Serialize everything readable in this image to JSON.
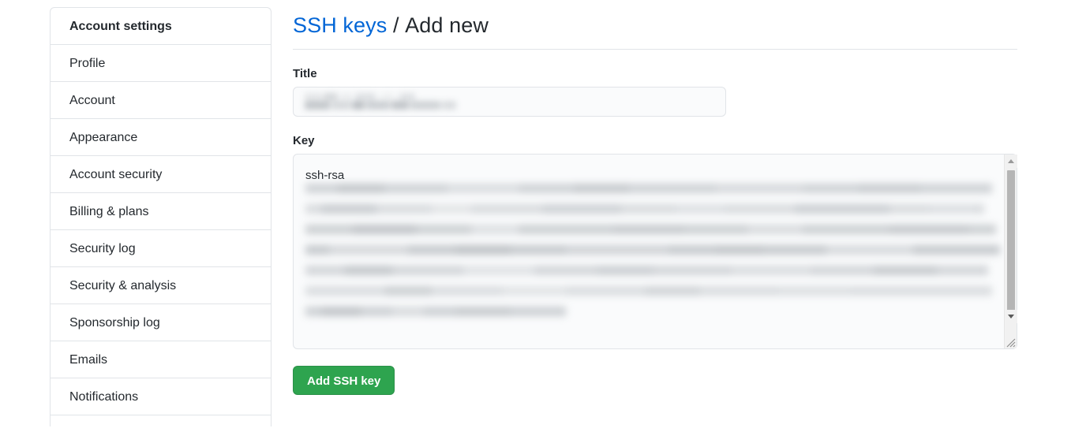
{
  "sidebar": {
    "header": "Account settings",
    "items": [
      {
        "label": "Profile"
      },
      {
        "label": "Account"
      },
      {
        "label": "Appearance"
      },
      {
        "label": "Account security"
      },
      {
        "label": "Billing & plans"
      },
      {
        "label": "Security log"
      },
      {
        "label": "Security & analysis"
      },
      {
        "label": "Sponsorship log"
      },
      {
        "label": "Emails"
      },
      {
        "label": "Notifications"
      }
    ],
    "clipped_item": ""
  },
  "header": {
    "breadcrumb_link": "SSH keys",
    "breadcrumb_separator": "/",
    "breadcrumb_current": "Add new"
  },
  "form": {
    "title_label": "Title",
    "title_value": "",
    "title_placeholder": "",
    "key_label": "Key",
    "key_value": "ssh-rsa",
    "key_placeholder": "",
    "submit_label": "Add SSH key"
  },
  "colors": {
    "link": "#0366d6",
    "text": "#24292e",
    "border": "#e1e4e8",
    "input_bg": "#fafbfc",
    "button_green": "#2ea44f",
    "redaction": "#c3c7cb"
  },
  "scrollbar": {
    "up_arrow": "chevron-up-icon",
    "down_arrow": "chevron-down-icon"
  }
}
